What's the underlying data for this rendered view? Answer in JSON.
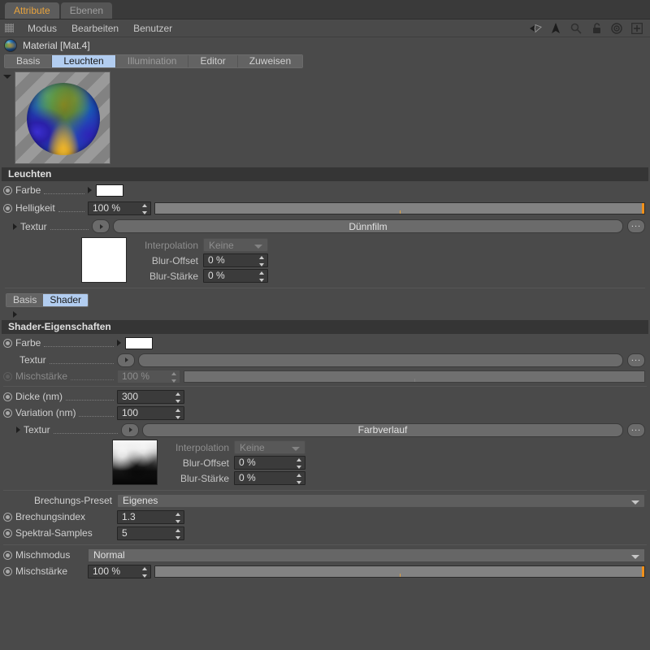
{
  "window": {
    "tabs": [
      {
        "label": "Attribute",
        "active": true
      },
      {
        "label": "Ebenen",
        "active": false
      }
    ]
  },
  "menubar": {
    "items": [
      "Modus",
      "Bearbeiten",
      "Benutzer"
    ],
    "icons": [
      "back-arrow-icon",
      "up-arrow-icon",
      "search-icon",
      "lock-icon",
      "target-icon",
      "plus-icon"
    ]
  },
  "material": {
    "title": "Material [Mat.4]",
    "icon": "material-sphere-icon"
  },
  "tabs": [
    {
      "label": "Basis",
      "active": false,
      "dim": false
    },
    {
      "label": "Leuchten",
      "active": true,
      "dim": false
    },
    {
      "label": "Illumination",
      "active": false,
      "dim": true
    },
    {
      "label": "Editor",
      "active": false,
      "dim": false
    },
    {
      "label": "Zuweisen",
      "active": false,
      "dim": false
    }
  ],
  "leuchten": {
    "header": "Leuchten",
    "farbe": {
      "label": "Farbe",
      "color": "#ffffff"
    },
    "helligkeit": {
      "label": "Helligkeit",
      "value": "100 %"
    },
    "textur": {
      "label": "Textur",
      "value": "Dünnfilm",
      "ellipsis": "..."
    },
    "interpolation": {
      "label": "Interpolation",
      "value": "Keine"
    },
    "blur_offset": {
      "label": "Blur-Offset",
      "value": "0 %"
    },
    "blur_staerke": {
      "label": "Blur-Stärke",
      "value": "0 %"
    }
  },
  "subtabs": [
    {
      "label": "Basis",
      "active": false
    },
    {
      "label": "Shader",
      "active": true
    }
  ],
  "shader": {
    "header": "Shader-Eigenschaften",
    "farbe": {
      "label": "Farbe",
      "color": "#ffffff"
    },
    "textur": {
      "label": "Textur",
      "value": "",
      "ellipsis": "..."
    },
    "mischstaerke": {
      "label": "Mischstärke",
      "value": "100 %"
    },
    "dicke": {
      "label": "Dicke (nm)",
      "value": "300"
    },
    "variation": {
      "label": "Variation (nm)",
      "value": "100"
    },
    "textur2": {
      "label": "Textur",
      "value": "Farbverlauf",
      "ellipsis": "..."
    },
    "interpolation2": {
      "label": "Interpolation",
      "value": "Keine"
    },
    "blur_offset2": {
      "label": "Blur-Offset",
      "value": "0 %"
    },
    "blur_staerke2": {
      "label": "Blur-Stärke",
      "value": "0 %"
    },
    "brechungs_preset": {
      "label": "Brechungs-Preset",
      "value": "Eigenes"
    },
    "brechungsindex": {
      "label": "Brechungsindex",
      "value": "1.3"
    },
    "spektral_samples": {
      "label": "Spektral-Samples",
      "value": "5"
    }
  },
  "footer": {
    "mischmodus": {
      "label": "Mischmodus",
      "value": "Normal"
    },
    "mischstaerke": {
      "label": "Mischstärke",
      "value": "100 %"
    }
  },
  "colors": {
    "accent_orange": "#f0901a",
    "tab_active_blue": "#b2cdf0",
    "panel_bg": "#4a4a4a",
    "section_header_bg": "#353535"
  }
}
